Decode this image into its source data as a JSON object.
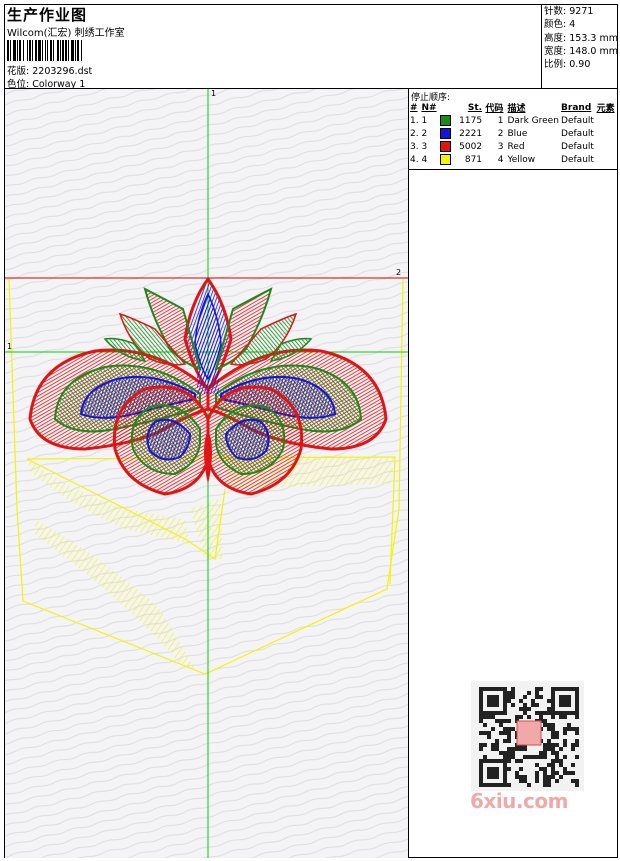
{
  "header": {
    "title": "生产作业图",
    "subtitle": "Wilcom(汇宏) 刺绣工作室",
    "design_label": "花版:",
    "design_value": "2203296.dst",
    "colorway_label": "色位:",
    "colorway_value": "Colorway 1"
  },
  "stats": {
    "stitches_label": "针数:",
    "stitches_value": "9271",
    "colors_label": "颜色:",
    "colors_value": "4",
    "height_label": "高度:",
    "height_value": "153.3 mm",
    "width_label": "宽度:",
    "width_value": "148.0 mm",
    "scale_label": "比例:",
    "scale_value": "0.90"
  },
  "stop_sequence": {
    "title": "停止顺序:",
    "columns": [
      "#",
      "N#",
      "St.",
      "代码",
      "描述",
      "Brand",
      "元素"
    ],
    "rows": [
      {
        "idx": "1.",
        "n": "1",
        "color": "#1a8a1a",
        "st": "1175",
        "code": "1",
        "desc": "Dark Green",
        "brand": "Default"
      },
      {
        "idx": "2.",
        "n": "2",
        "color": "#1515d8",
        "st": "2221",
        "code": "2",
        "desc": "Blue",
        "brand": "Default"
      },
      {
        "idx": "3.",
        "n": "3",
        "color": "#e01414",
        "st": "5002",
        "code": "3",
        "desc": "Red",
        "brand": "Default"
      },
      {
        "idx": "4.",
        "n": "4",
        "color": "#f4f400",
        "st": "871",
        "code": "4",
        "desc": "Yellow",
        "brand": "Default"
      }
    ]
  },
  "guides": {
    "v_label": "1",
    "h_top_label": "2",
    "h_mid_label": "1"
  },
  "watermark": "6xiu.com",
  "colors": {
    "green": "#1a8a1a",
    "blue": "#1515d8",
    "red": "#e01414",
    "yellow": "#f4f400",
    "guide_green": "#00d400",
    "guide_red": "#d40000"
  }
}
